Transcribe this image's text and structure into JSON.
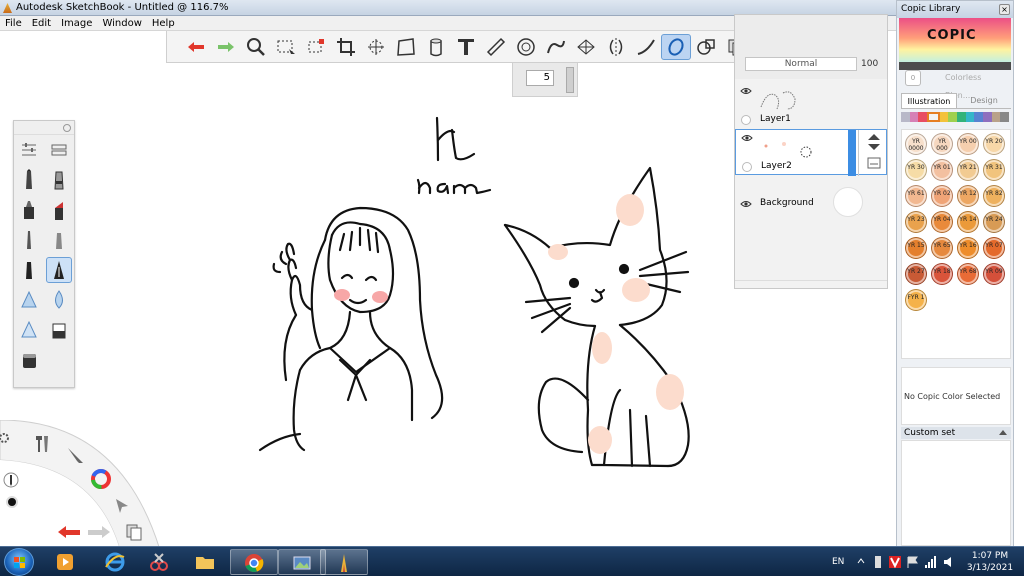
{
  "window": {
    "title": "Autodesk SketchBook - Untitled @ 116.7%"
  },
  "menu": {
    "items": [
      "File",
      "Edit",
      "Image",
      "Window",
      "Help"
    ]
  },
  "toolbar": {
    "tools": [
      "undo-icon",
      "redo-icon",
      "zoom-icon",
      "rect-select-icon",
      "lasso-select-icon",
      "crop-icon",
      "transform-icon",
      "distort-icon",
      "fill-icon",
      "text-icon",
      "ruler-icon",
      "ellipse-guide-icon",
      "french-curve-icon",
      "perspective-icon",
      "symmetry-icon",
      "stroke-icon",
      "ellipse-tool-icon",
      "shape-icon",
      "copy-paste-icon",
      "brush-library-icon",
      "color-wheel-icon",
      "layers-icon"
    ],
    "active_tool": "ellipse-tool-icon"
  },
  "brush_size": {
    "value": "5"
  },
  "layers": {
    "blend_mode": "Normal",
    "opacity": "100",
    "items": [
      {
        "name": "Layer1"
      },
      {
        "name": "Layer2"
      },
      {
        "name": "Background"
      }
    ]
  },
  "copic": {
    "title": "Copic Library",
    "logo": "COPIC",
    "blender_label": "Colorless Blen...",
    "blender_code": "0",
    "tabs": [
      "Illustration",
      "Design"
    ],
    "swatches": [
      {
        "code": "YR 0000",
        "color": "#f7e0cc"
      },
      {
        "code": "YR 000",
        "color": "#f6d7bf"
      },
      {
        "code": "YR 00",
        "color": "#f6cfae"
      },
      {
        "code": "YR 20",
        "color": "#f7d7a8"
      },
      {
        "code": "YR 30",
        "color": "#f6dca6"
      },
      {
        "code": "YR 01",
        "color": "#f3c0a0"
      },
      {
        "code": "YR 21",
        "color": "#f2cb92"
      },
      {
        "code": "YR 31",
        "color": "#f1c47d"
      },
      {
        "code": "YR 61",
        "color": "#f2b890"
      },
      {
        "code": "YR 02",
        "color": "#f0a477"
      },
      {
        "code": "YR 12",
        "color": "#eda763"
      },
      {
        "code": "YR 82",
        "color": "#eeb15e"
      },
      {
        "code": "YR 23",
        "color": "#e9a24d"
      },
      {
        "code": "YR 04",
        "color": "#e98a3b"
      },
      {
        "code": "YR 14",
        "color": "#eb9a3a"
      },
      {
        "code": "YR 24",
        "color": "#d89b55"
      },
      {
        "code": "YR 15",
        "color": "#e47f2d"
      },
      {
        "code": "YR 65",
        "color": "#e6893e"
      },
      {
        "code": "YR 16",
        "color": "#ee8d2b"
      },
      {
        "code": "YR 07",
        "color": "#e46a2b"
      },
      {
        "code": "YR 27",
        "color": "#c85a35"
      },
      {
        "code": "YR 18",
        "color": "#d9543a"
      },
      {
        "code": "YR 68",
        "color": "#e86b36"
      },
      {
        "code": "YR 09",
        "color": "#d4503a"
      },
      {
        "code": "FYR 1",
        "color": "#f5b24a"
      }
    ],
    "status": "No Copic Color Selected",
    "custom_set": "Custom set"
  },
  "taskbar": {
    "apps": [
      "start-button",
      "media-player-icon",
      "internet-explorer-icon",
      "snipping-tool-icon",
      "file-explorer-icon",
      "chrome-icon",
      "photo-viewer-icon",
      "sketchbook-icon"
    ],
    "lang": "EN",
    "time": "1:07 PM",
    "date": "3/13/2021"
  },
  "canvas": {
    "text": "Hi ham"
  }
}
